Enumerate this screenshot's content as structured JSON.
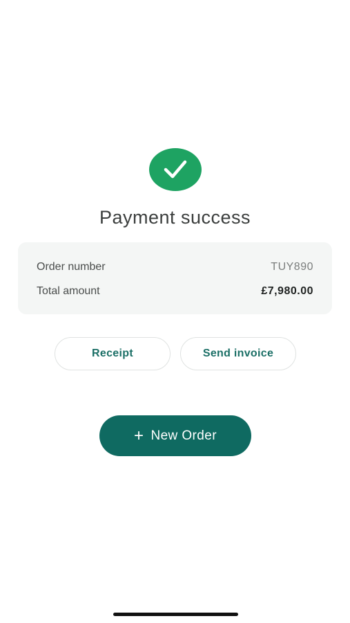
{
  "status": {
    "icon": "checkmark-icon",
    "title": "Payment success",
    "accent_color": "#1ea362"
  },
  "summary": {
    "order_number_label": "Order number",
    "order_number_value": "TUY890",
    "total_amount_label": "Total amount",
    "total_amount_value": "£7,980.00"
  },
  "actions": {
    "receipt_label": "Receipt",
    "send_invoice_label": "Send invoice",
    "new_order_label": "New Order",
    "new_order_icon": "plus-icon",
    "primary_color": "#0f6a61"
  }
}
